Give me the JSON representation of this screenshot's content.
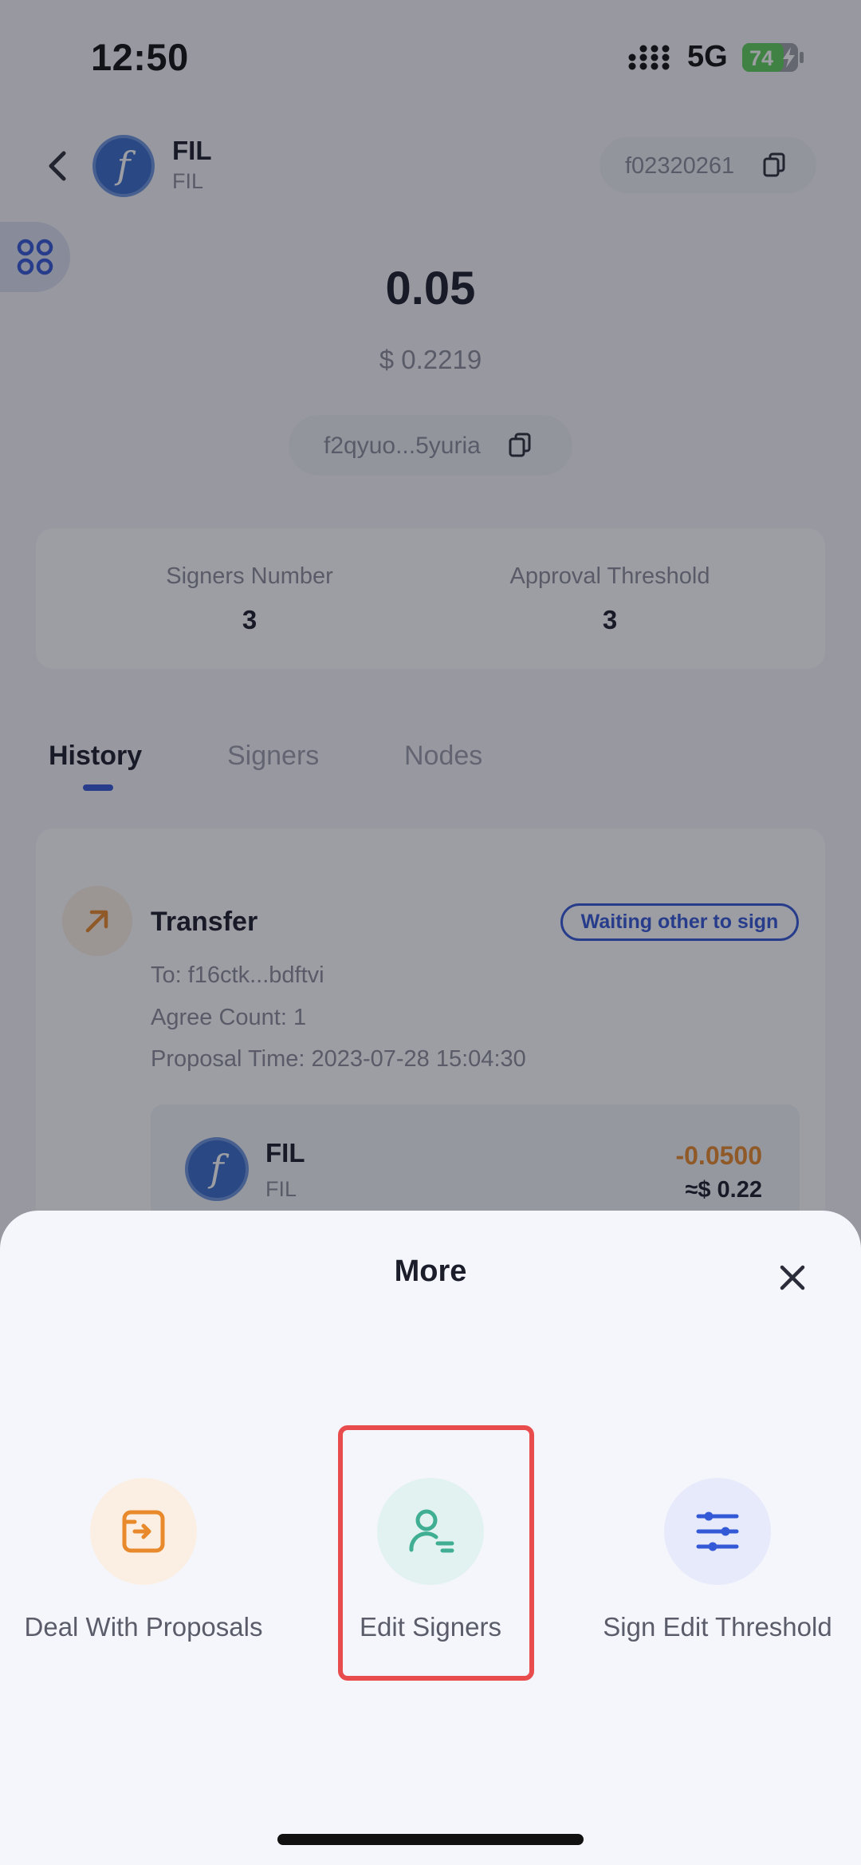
{
  "status_bar": {
    "time": "12:50",
    "network": "5G",
    "battery": "74"
  },
  "header": {
    "token_symbol": "FIL",
    "token_name": "FIL",
    "account_id": "f02320261"
  },
  "balance": {
    "amount": "0.05",
    "fiat": "$ 0.2219",
    "wallet_address": "f2qyuo...5yuria"
  },
  "stats": {
    "signers_label": "Signers Number",
    "signers_value": "3",
    "threshold_label": "Approval Threshold",
    "threshold_value": "3"
  },
  "tabs": [
    {
      "label": "History",
      "active": true
    },
    {
      "label": "Signers",
      "active": false
    },
    {
      "label": "Nodes",
      "active": false
    }
  ],
  "history": {
    "title": "Transfer",
    "status": "Waiting other to sign",
    "to": "To: f16ctk...bdftvi",
    "agree_count": "Agree Count: 1",
    "proposal_time": "Proposal Time: 2023-07-28 15:04:30",
    "asset_symbol": "FIL",
    "asset_name": "FIL",
    "amount": "-0.0500",
    "amount_fiat": "≈$ 0.22"
  },
  "sheet": {
    "title": "More",
    "options": [
      {
        "label": "Deal With Proposals",
        "icon": "proposal-icon",
        "color": "#e8892c"
      },
      {
        "label": "Edit Signers",
        "icon": "user-edit-icon",
        "color": "#3fae93"
      },
      {
        "label": "Sign Edit Threshold",
        "icon": "sliders-icon",
        "color": "#3459d6"
      }
    ]
  }
}
